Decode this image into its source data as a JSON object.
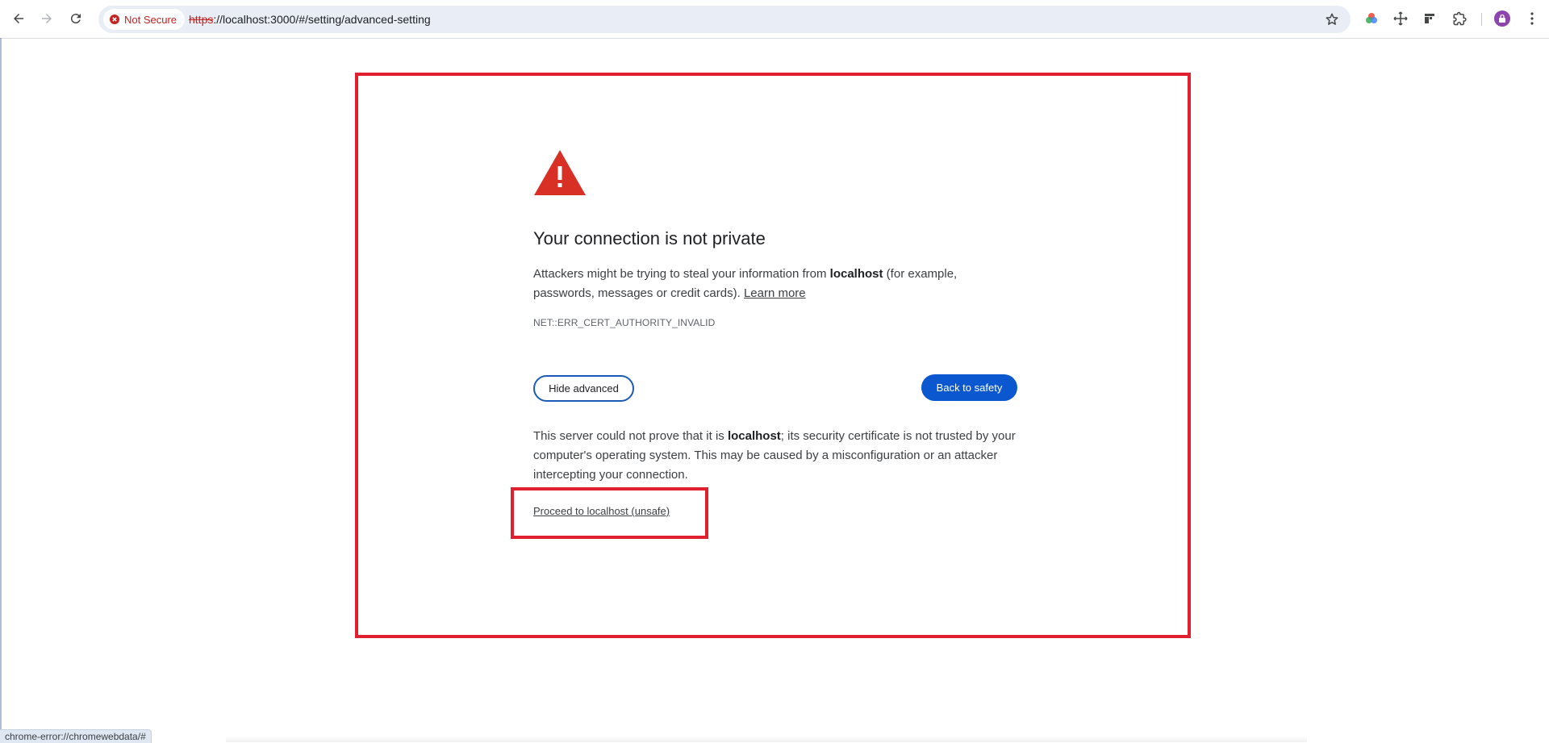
{
  "browser": {
    "security_chip": "Not Secure",
    "url_scheme": "https",
    "url_rest": "://localhost:3000/#/setting/advanced-setting",
    "status_url": "chrome-error://chromewebdata/#"
  },
  "interstitial": {
    "heading": "Your connection is not private",
    "intro_prefix": "Attackers might be trying to steal your information from ",
    "intro_host": "localhost",
    "intro_suffix": " (for example, passwords, messages or credit cards). ",
    "learn_more": "Learn more",
    "error_code": "NET::ERR_CERT_AUTHORITY_INVALID",
    "hide_advanced": "Hide advanced",
    "back_to_safety": "Back to safety",
    "details_prefix": "This server could not prove that it is ",
    "details_host": "localhost",
    "details_suffix": "; its security certificate is not trusted by your computer's operating system. This may be caused by a misconfiguration or an attacker intercepting your connection.",
    "proceed_link": "Proceed to localhost (unsafe)"
  },
  "colors": {
    "highlight": "#e0202e",
    "primary_button": "#0b57d0",
    "warning_icon": "#d93025"
  }
}
